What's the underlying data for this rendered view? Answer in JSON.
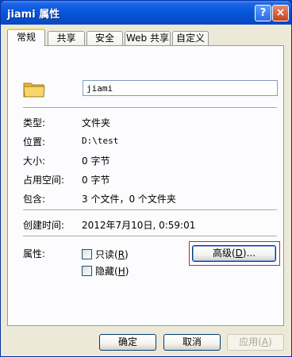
{
  "window": {
    "title": "jiami 属性",
    "help": "?",
    "close": "×"
  },
  "tabs": [
    {
      "label": "常规"
    },
    {
      "label": "共享"
    },
    {
      "label": "安全"
    },
    {
      "label": "Web 共享"
    },
    {
      "label": "自定义"
    }
  ],
  "general": {
    "name": "jiami",
    "rows": [
      {
        "label": "类型:",
        "value": "文件夹"
      },
      {
        "label": "位置:",
        "value": "D:\\test"
      },
      {
        "label": "大小:",
        "value": "0 字节"
      },
      {
        "label": "占用空间:",
        "value": "0 字节"
      },
      {
        "label": "包含:",
        "value": "3 个文件，0 个文件夹"
      }
    ],
    "created_label": "创建时间:",
    "created_value": "2012年7月10日, 0:59:01",
    "attributes_label": "属性:",
    "readonly": {
      "text": "只读",
      "key": "R",
      "checked": false
    },
    "hidden": {
      "text": "隐藏",
      "key": "H",
      "checked": false
    },
    "advanced_button": {
      "text": "高级",
      "key": "D",
      "suffix": "..."
    }
  },
  "footer": {
    "ok": "确定",
    "cancel": "取消",
    "apply": "应用",
    "apply_key": "A"
  },
  "colors": {
    "highlight": "#d82020",
    "titlebar": "#0756dc"
  }
}
